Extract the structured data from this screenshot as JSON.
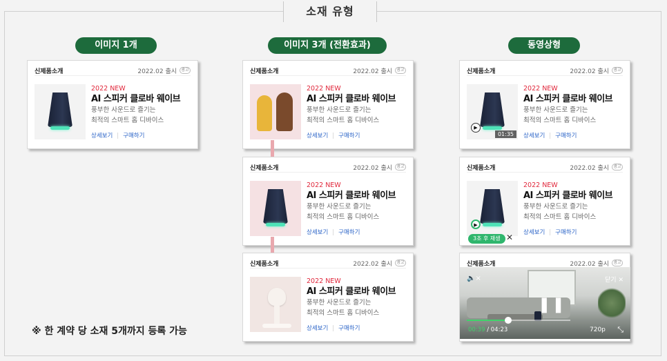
{
  "title": "소재 유형",
  "columns": [
    {
      "label": "이미지 1개"
    },
    {
      "label": "이미지 3개 (전환효과)"
    },
    {
      "label": "동영상형"
    }
  ],
  "card": {
    "header_left": "신제품소개",
    "header_right": "2022.02 출시",
    "ad_badge": "광고",
    "tag": "2022 NEW",
    "name": "AI 스피커 클로바 웨이브",
    "desc1": "풍부한 사운드로 즐기는",
    "desc2": "최적의 스마트 홈 디바이스",
    "link_detail": "상세보기",
    "link_buy": "구매하기"
  },
  "video_card": {
    "duration": "01:35",
    "replay_label": "3초 후 재생",
    "close_label": "닫기",
    "current_time": "00:39",
    "total_time": "/ 04:23",
    "quality": "720p",
    "progress": 0.4
  },
  "note": "※ 한 계약 당 소재 5개까지 등록 가능",
  "colors": {
    "accent": "#1d6b3c",
    "new_tag": "#e0263a",
    "link": "#2a63c7",
    "progress": "#3fd36a"
  }
}
